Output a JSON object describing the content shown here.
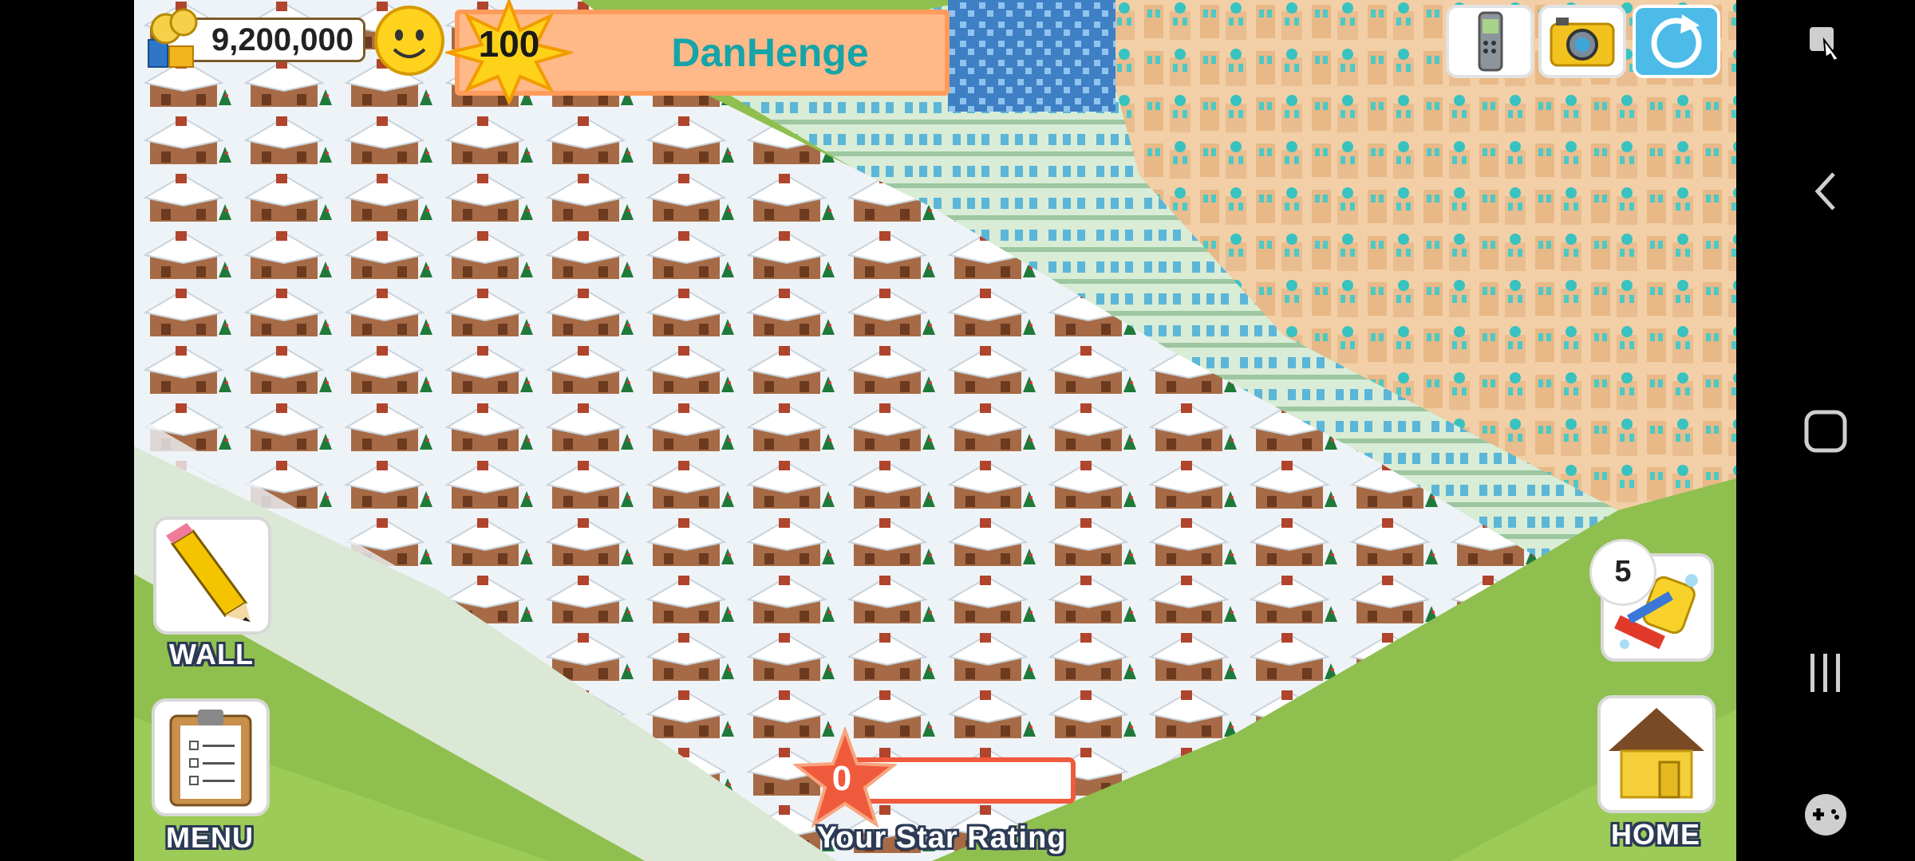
{
  "hud": {
    "coins": "9,200,000",
    "level": "100",
    "player_name": "DanHenge",
    "star_rating_value": "0",
    "star_rating_label": "Your Star Rating",
    "star_rating_progress": 0
  },
  "buttons": {
    "wall": "WALL",
    "menu": "MENU",
    "home": "HOME",
    "tidy_count": "5"
  },
  "icons": {
    "top_right": [
      "phone-icon",
      "camera-icon",
      "share-icon"
    ],
    "left": [
      "pencil-icon",
      "clipboard-icon"
    ],
    "right": [
      "cleanup-icon",
      "house-icon"
    ],
    "nav": [
      "screenshot-edit-icon",
      "back-icon",
      "home-icon",
      "recents-icon",
      "game-tools-icon"
    ]
  },
  "colors": {
    "grass": "#8fbf4e",
    "banner": "#ffb988",
    "name": "#15a4a8",
    "star": "#f05a3c"
  }
}
